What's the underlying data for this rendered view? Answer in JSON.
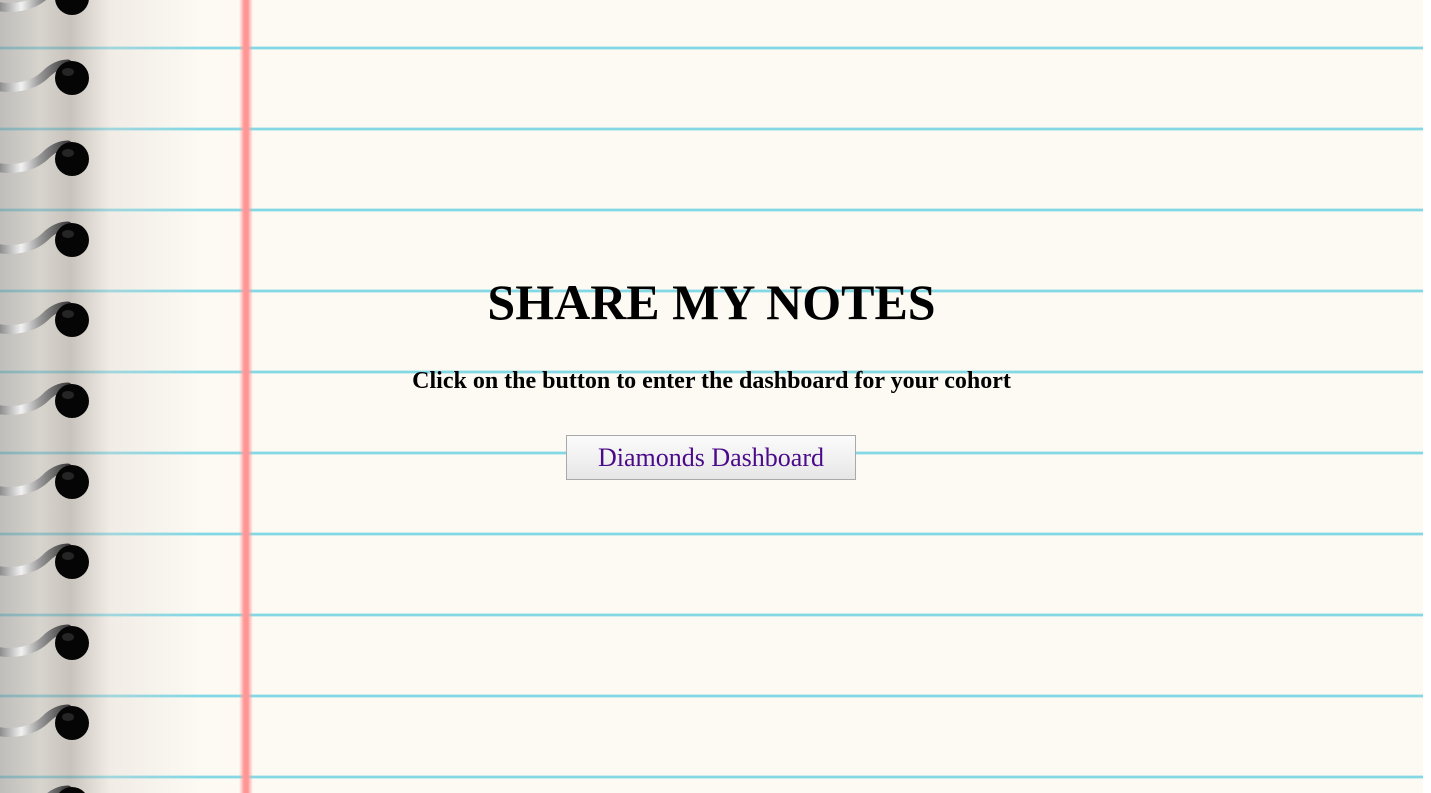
{
  "page": {
    "title": "SHARE MY NOTES",
    "subtitle": "Click on the button to enter the dashboard for your cohort",
    "dashboard_button_label": "Diamonds Dashboard"
  },
  "decor": {
    "paper_color": "#fcfaf3",
    "rule_line_color": "#6ed2e4",
    "margin_line_color": "#ff9696",
    "button_text_color": "#4b0a8a",
    "binding_icon": "spiral-ring-icon"
  }
}
